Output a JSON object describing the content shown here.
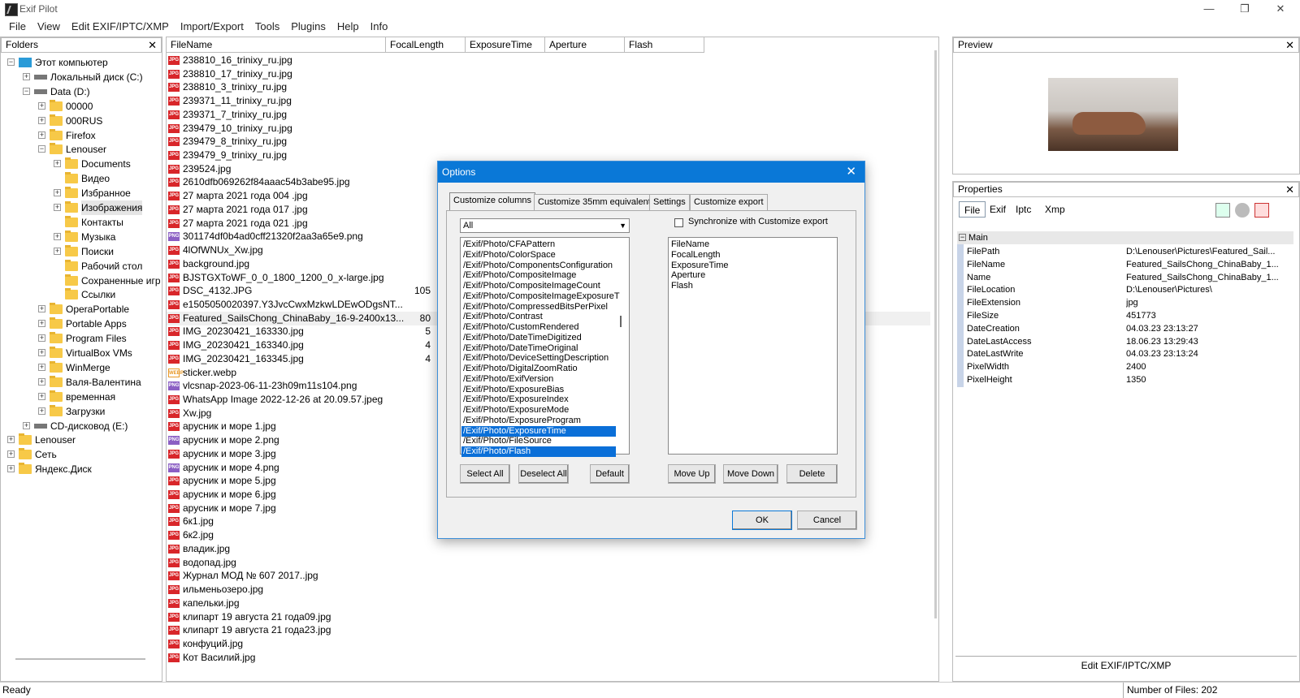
{
  "window": {
    "title": "Exif Pilot",
    "minimize": "—",
    "maximize": "❐",
    "close": "✕"
  },
  "menu": [
    "File",
    "View",
    "Edit EXIF/IPTC/XMP",
    "Import/Export",
    "Tools",
    "Plugins",
    "Help",
    "Info"
  ],
  "folders": {
    "header": "Folders",
    "close": "✕",
    "tree": [
      {
        "label": "Этот компьютер",
        "depth": 0,
        "exp": "−",
        "icon": "pc"
      },
      {
        "label": "Локальный диск (C:)",
        "depth": 1,
        "exp": "+",
        "icon": "drive"
      },
      {
        "label": "Data (D:)",
        "depth": 1,
        "exp": "−",
        "icon": "drive"
      },
      {
        "label": "00000",
        "depth": 2,
        "exp": "+",
        "icon": "folder"
      },
      {
        "label": "000RUS",
        "depth": 2,
        "exp": "+",
        "icon": "folder"
      },
      {
        "label": "Firefox",
        "depth": 2,
        "exp": "+",
        "icon": "folder"
      },
      {
        "label": "Lenouser",
        "depth": 2,
        "exp": "−",
        "icon": "folder"
      },
      {
        "label": "Documents",
        "depth": 3,
        "exp": "+",
        "icon": "folder"
      },
      {
        "label": "Видео",
        "depth": 3,
        "exp": "",
        "icon": "folder"
      },
      {
        "label": "Избранное",
        "depth": 3,
        "exp": "+",
        "icon": "folder"
      },
      {
        "label": "Изображения",
        "depth": 3,
        "exp": "+",
        "icon": "folder",
        "selected": true
      },
      {
        "label": "Контакты",
        "depth": 3,
        "exp": "",
        "icon": "folder"
      },
      {
        "label": "Музыка",
        "depth": 3,
        "exp": "+",
        "icon": "folder"
      },
      {
        "label": "Поиски",
        "depth": 3,
        "exp": "+",
        "icon": "folder"
      },
      {
        "label": "Рабочий стол",
        "depth": 3,
        "exp": "",
        "icon": "folder"
      },
      {
        "label": "Сохраненные игр",
        "depth": 3,
        "exp": "",
        "icon": "folder"
      },
      {
        "label": "Ссылки",
        "depth": 3,
        "exp": "",
        "icon": "folder"
      },
      {
        "label": "OperaPortable",
        "depth": 2,
        "exp": "+",
        "icon": "folder"
      },
      {
        "label": "Portable Apps",
        "depth": 2,
        "exp": "+",
        "icon": "folder"
      },
      {
        "label": "Program Files",
        "depth": 2,
        "exp": "+",
        "icon": "folder"
      },
      {
        "label": "VirtualBox VMs",
        "depth": 2,
        "exp": "+",
        "icon": "folder"
      },
      {
        "label": "WinMerge",
        "depth": 2,
        "exp": "+",
        "icon": "folder"
      },
      {
        "label": "Валя-Валентина",
        "depth": 2,
        "exp": "+",
        "icon": "folder"
      },
      {
        "label": "временная",
        "depth": 2,
        "exp": "+",
        "icon": "folder"
      },
      {
        "label": "Загрузки",
        "depth": 2,
        "exp": "+",
        "icon": "folder"
      },
      {
        "label": "CD-дисковод (E:)",
        "depth": 1,
        "exp": "+",
        "icon": "drive"
      },
      {
        "label": "Lenouser",
        "depth": 0,
        "exp": "+",
        "icon": "folder"
      },
      {
        "label": "Сеть",
        "depth": 0,
        "exp": "+",
        "icon": "folder"
      },
      {
        "label": "Яндекс.Диск",
        "depth": 0,
        "exp": "+",
        "icon": "folder"
      }
    ]
  },
  "filelist": {
    "columns": [
      "FileName",
      "FocalLength",
      "ExposureTime",
      "Aperture",
      "Flash"
    ],
    "rows": [
      {
        "name": "238810_16_trinixy_ru.jpg",
        "type": "JPG",
        "val": ""
      },
      {
        "name": "238810_17_trinixy_ru.jpg",
        "type": "JPG",
        "val": ""
      },
      {
        "name": "238810_3_trinixy_ru.jpg",
        "type": "JPG",
        "val": ""
      },
      {
        "name": "239371_11_trinixy_ru.jpg",
        "type": "JPG",
        "val": ""
      },
      {
        "name": "239371_7_trinixy_ru.jpg",
        "type": "JPG",
        "val": ""
      },
      {
        "name": "239479_10_trinixy_ru.jpg",
        "type": "JPG",
        "val": ""
      },
      {
        "name": "239479_8_trinixy_ru.jpg",
        "type": "JPG",
        "val": ""
      },
      {
        "name": "239479_9_trinixy_ru.jpg",
        "type": "JPG",
        "val": ""
      },
      {
        "name": "239524.jpg",
        "type": "JPG",
        "val": ""
      },
      {
        "name": "2610dfb069262f84aaac54b3abe95.jpg",
        "type": "JPG",
        "val": ""
      },
      {
        "name": "27 марта 2021 года 004 .jpg",
        "type": "JPG",
        "val": ""
      },
      {
        "name": "27 марта 2021 года 017 .jpg",
        "type": "JPG",
        "val": ""
      },
      {
        "name": "27 марта 2021 года 021 .jpg",
        "type": "JPG",
        "val": ""
      },
      {
        "name": "301174df0b4ad0cff21320f2aa3a65e9.png",
        "type": "PNG",
        "val": ""
      },
      {
        "name": "4lOfWNUx_Xw.jpg",
        "type": "JPG",
        "val": ""
      },
      {
        "name": "background.jpg",
        "type": "JPG",
        "val": ""
      },
      {
        "name": "BJSTGXToWF_0_0_1800_1200_0_x-large.jpg",
        "type": "JPG",
        "val": ""
      },
      {
        "name": "DSC_4132.JPG",
        "type": "JPG",
        "val": "105"
      },
      {
        "name": "e1505050020397.Y3JvcCwxMzkwLDEwODgsNT...",
        "type": "JPG",
        "val": ""
      },
      {
        "name": "Featured_SailsChong_ChinaBaby_16-9-2400x13...",
        "type": "JPG",
        "val": "80",
        "selected": true
      },
      {
        "name": "IMG_20230421_163330.jpg",
        "type": "JPG",
        "val": "5"
      },
      {
        "name": "IMG_20230421_163340.jpg",
        "type": "JPG",
        "val": "4"
      },
      {
        "name": "IMG_20230421_163345.jpg",
        "type": "JPG",
        "val": "4"
      },
      {
        "name": "sticker.webp",
        "type": "WEBP",
        "val": ""
      },
      {
        "name": "vlcsnap-2023-06-11-23h09m11s104.png",
        "type": "PNG",
        "val": ""
      },
      {
        "name": "WhatsApp Image 2022-12-26 at 20.09.57.jpeg",
        "type": "JPG",
        "val": ""
      },
      {
        "name": "Xw.jpg",
        "type": "JPG",
        "val": ""
      },
      {
        "name": "арусник и море 1.jpg",
        "type": "JPG",
        "val": ""
      },
      {
        "name": "арусник и море 2.png",
        "type": "PNG",
        "val": ""
      },
      {
        "name": "арусник и море 3.jpg",
        "type": "JPG",
        "val": ""
      },
      {
        "name": "арусник и море 4.png",
        "type": "PNG",
        "val": ""
      },
      {
        "name": "арусник и море 5.jpg",
        "type": "JPG",
        "val": ""
      },
      {
        "name": "арусник и море 6.jpg",
        "type": "JPG",
        "val": ""
      },
      {
        "name": "арусник и море 7.jpg",
        "type": "JPG",
        "val": ""
      },
      {
        "name": "6к1.jpg",
        "type": "JPG",
        "val": ""
      },
      {
        "name": "6к2.jpg",
        "type": "JPG",
        "val": ""
      },
      {
        "name": "владик.jpg",
        "type": "JPG",
        "val": ""
      },
      {
        "name": "водопад.jpg",
        "type": "JPG",
        "val": ""
      },
      {
        "name": "Журнал МОД № 607 2017..jpg",
        "type": "JPG",
        "val": ""
      },
      {
        "name": "ильменьозеро.jpg",
        "type": "JPG",
        "val": ""
      },
      {
        "name": "капельки.jpg",
        "type": "JPG",
        "val": ""
      },
      {
        "name": "клипарт 19 августа 21 года09.jpg",
        "type": "JPG",
        "val": ""
      },
      {
        "name": "клипарт 19 августа 21 года23.jpg",
        "type": "JPG",
        "val": ""
      },
      {
        "name": "конфуций.jpg",
        "type": "JPG",
        "val": ""
      },
      {
        "name": "Кот Василий.jpg",
        "type": "JPG",
        "val": ""
      }
    ]
  },
  "preview": {
    "header": "Preview",
    "close": "✕"
  },
  "properties": {
    "header": "Properties",
    "close": "✕",
    "tabs": [
      "File",
      "Exif",
      "Iptc",
      "Xmp"
    ],
    "group": "Main",
    "rows": [
      {
        "k": "FilePath",
        "v": "D:\\Lenouser\\Pictures\\Featured_Sail..."
      },
      {
        "k": "FileName",
        "v": "Featured_SailsChong_ChinaBaby_1..."
      },
      {
        "k": "Name",
        "v": "Featured_SailsChong_ChinaBaby_1..."
      },
      {
        "k": "FileLocation",
        "v": "D:\\Lenouser\\Pictures\\"
      },
      {
        "k": "FileExtension",
        "v": "jpg"
      },
      {
        "k": "FileSize",
        "v": "451773"
      },
      {
        "k": "DateCreation",
        "v": "04.03.23 23:13:27"
      },
      {
        "k": "DateLastAccess",
        "v": "18.06.23 13:29:43"
      },
      {
        "k": "DateLastWrite",
        "v": "04.03.23 23:13:24"
      },
      {
        "k": "PixelWidth",
        "v": "2400"
      },
      {
        "k": "PixelHeight",
        "v": "1350"
      }
    ],
    "edit_button": "Edit EXIF/IPTC/XMP"
  },
  "status": {
    "left": "Ready",
    "right": "Number of Files: 202"
  },
  "dialog": {
    "title": "Options",
    "close": "✕",
    "tabs": [
      "Customize columns",
      "Customize 35mm equivalent",
      "Settings",
      "Customize export"
    ],
    "filter_value": "All",
    "sync_label": "Synchronize with Customize export",
    "available": [
      "/Exif/Photo/CFAPattern",
      "/Exif/Photo/ColorSpace",
      "/Exif/Photo/ComponentsConfiguration",
      "/Exif/Photo/CompositeImage",
      "/Exif/Photo/CompositeImageCount",
      "/Exif/Photo/CompositeImageExposureT",
      "/Exif/Photo/CompressedBitsPerPixel",
      "/Exif/Photo/Contrast",
      "/Exif/Photo/CustomRendered",
      "/Exif/Photo/DateTimeDigitized",
      "/Exif/Photo/DateTimeOriginal",
      "/Exif/Photo/DeviceSettingDescription",
      "/Exif/Photo/DigitalZoomRatio",
      "/Exif/Photo/ExifVersion",
      "/Exif/Photo/ExposureBias",
      "/Exif/Photo/ExposureIndex",
      "/Exif/Photo/ExposureMode",
      "/Exif/Photo/ExposureProgram",
      "/Exif/Photo/ExposureTime",
      "/Exif/Photo/FileSource",
      "/Exif/Photo/Flash"
    ],
    "selected_available": [
      "/Exif/Photo/ExposureTime",
      "/Exif/Photo/Flash"
    ],
    "chosen": [
      "FileName",
      "FocalLength",
      "ExposureTime",
      "Aperture",
      "Flash"
    ],
    "buttons_left": [
      "Select All",
      "Deselect All",
      "Default"
    ],
    "buttons_right": [
      "Move Up",
      "Move Down",
      "Delete"
    ],
    "ok": "OK",
    "cancel": "Cancel"
  }
}
